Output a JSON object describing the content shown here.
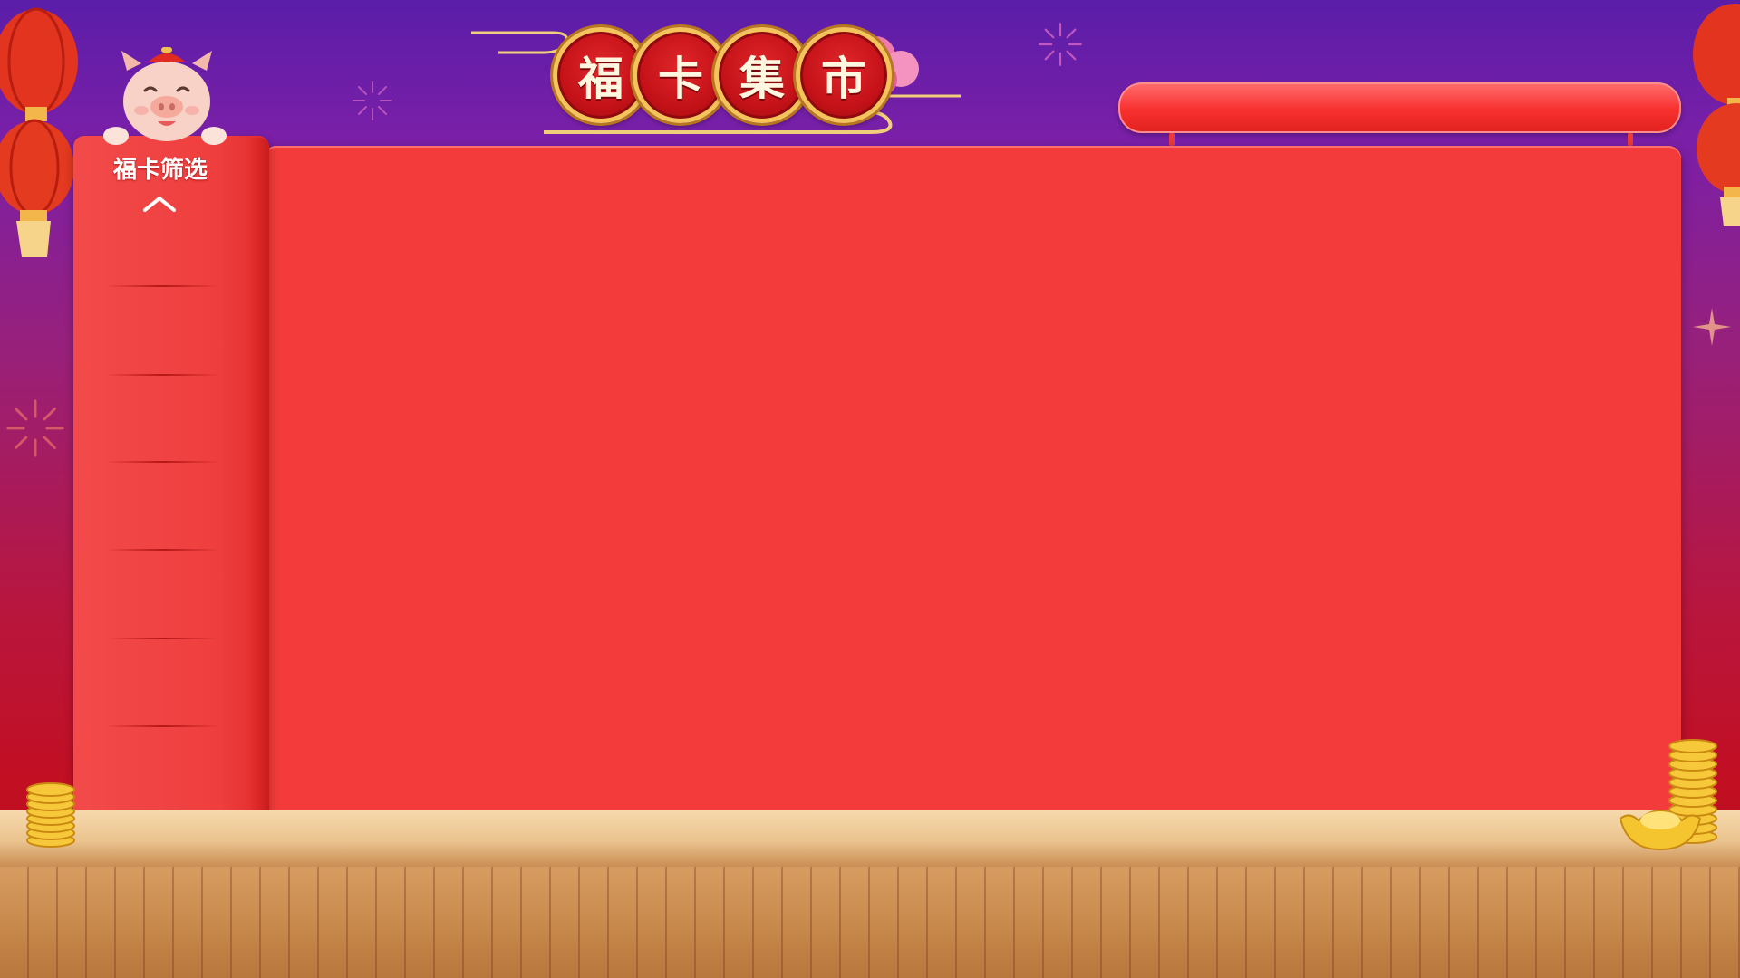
{
  "title": {
    "characters": [
      "福",
      "卡",
      "集",
      "市"
    ]
  },
  "filter_panel": {
    "title": "福卡筛选",
    "scroll_up_icon": "chevron-up-icon",
    "scroll_down_icon": "chevron-down-icon",
    "items": [
      "",
      "",
      "",
      "",
      "",
      "",
      ""
    ]
  },
  "top_bar": {
    "label": ""
  },
  "colors": {
    "panel_red": "#f23b3a",
    "gold": "#f3c35c",
    "wood": "#d79c61"
  }
}
